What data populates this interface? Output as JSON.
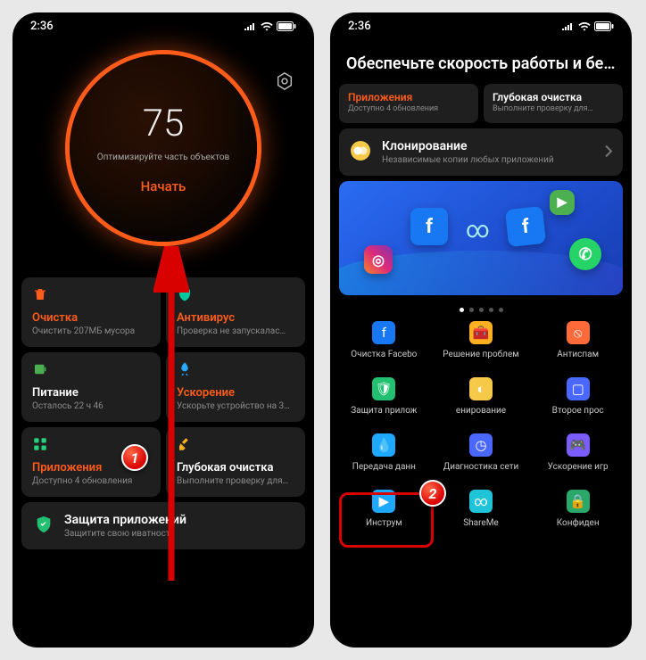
{
  "status": {
    "time": "2:36"
  },
  "left": {
    "score": "75",
    "score_sub": "Оптимизируйте часть объектов",
    "score_action": "Начать",
    "cards": [
      {
        "title": "Очистка",
        "sub": "Очистить 207МБ мусора",
        "alert": true,
        "icon": "trash-icon",
        "color": "#ff5c1a"
      },
      {
        "title": "Антивирус",
        "sub": "Проверка не запускалас…",
        "alert": true,
        "icon": "shield-icon",
        "color": "#00c8a0"
      },
      {
        "title": "Питание",
        "sub": "Осталось 22 ч 46",
        "alert": false,
        "icon": "battery-icon",
        "color": "#4caf50"
      },
      {
        "title": "Ускорение",
        "sub": "Ускорьте устройство на 3…",
        "alert": true,
        "icon": "rocket-icon",
        "color": "#2aa8ff"
      },
      {
        "title": "Приложения",
        "sub": "Доступно 4 обновления",
        "alert": true,
        "icon": "apps-icon",
        "color": "#26d07c"
      },
      {
        "title": "Глубокая очистка",
        "sub": "Выполните проверку для…",
        "alert": false,
        "icon": "broom-icon",
        "color": "#ffb020"
      }
    ],
    "protect": {
      "title": "Защита приложений",
      "sub": "Защитите свою   иватность"
    }
  },
  "right": {
    "header": "Обеспечьте скорость работы и бе…",
    "mini_cards": [
      {
        "title": "Приложения",
        "sub": "Доступно 4 обновления",
        "alert": true
      },
      {
        "title": "Глубокая очистка",
        "sub": "Выполните проверку для…",
        "alert": false
      }
    ],
    "clone": {
      "title": "Клонирование",
      "sub": "Независимые копии любых приложений"
    },
    "grid": [
      {
        "label": "Очистка Facebo",
        "color": "#1877f2",
        "name": "facebook-clean"
      },
      {
        "label": "Решение проблем",
        "color": "#ffb020",
        "name": "troubleshoot"
      },
      {
        "label": "Антиспам",
        "color": "#ff6a3a",
        "name": "antispam"
      },
      {
        "label": "Защита прилож",
        "color": "#22c070",
        "name": "app-protect"
      },
      {
        "label": "енирование",
        "color": "#f7c948",
        "name": "clone"
      },
      {
        "label": "Второе прос",
        "color": "#4a68ff",
        "name": "second-space"
      },
      {
        "label": "Передача данн",
        "color": "#1fa8ff",
        "name": "data-transfer"
      },
      {
        "label": "Диагностика сети",
        "color": "#4a68ff",
        "name": "net-diag"
      },
      {
        "label": "Ускорение игр",
        "color": "#7a5cff",
        "name": "game-boost"
      },
      {
        "label": "Инструм",
        "color": "#1fa8ff",
        "name": "tools"
      },
      {
        "label": "ShareMe",
        "color": "#20c4d8",
        "name": "shareme"
      },
      {
        "label": "Конфиден",
        "color": "#2aa86a",
        "name": "privacy"
      }
    ]
  },
  "annotations": {
    "step1": "1",
    "step2": "2"
  }
}
